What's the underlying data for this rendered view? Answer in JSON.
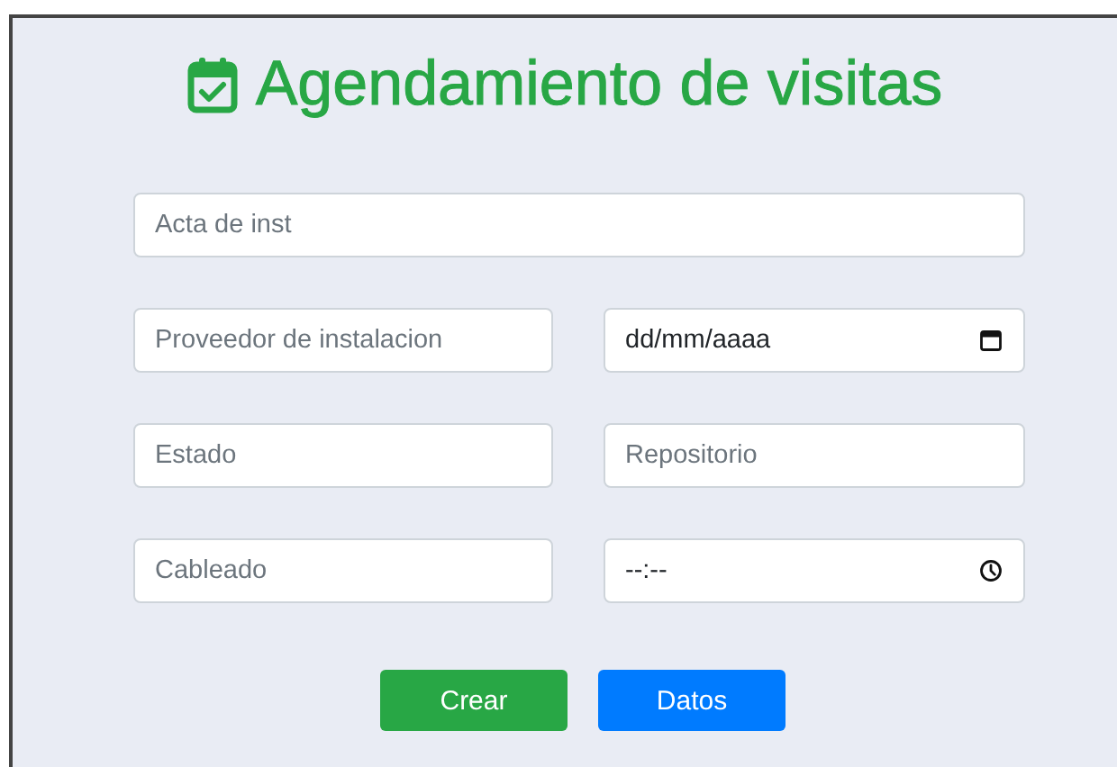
{
  "title": "Agendamiento de visitas",
  "fields": [
    {
      "kind": "text",
      "placeholder": "Acta de inst",
      "wide": true
    },
    {
      "kind": "text",
      "placeholder": "Proveedor de instalacion",
      "wide": false
    },
    {
      "kind": "date",
      "value": "dd/mm/aaaa",
      "wide": false
    },
    {
      "kind": "text",
      "placeholder": "Estado",
      "wide": false
    },
    {
      "kind": "text",
      "placeholder": "Repositorio",
      "wide": false
    },
    {
      "kind": "text",
      "placeholder": "Cableado",
      "wide": false
    },
    {
      "kind": "time",
      "value": "--:--",
      "wide": false
    }
  ],
  "buttons": [
    {
      "label": "Crear",
      "color": "#28a745"
    },
    {
      "label": "Datos",
      "color": "#007bff"
    }
  ]
}
